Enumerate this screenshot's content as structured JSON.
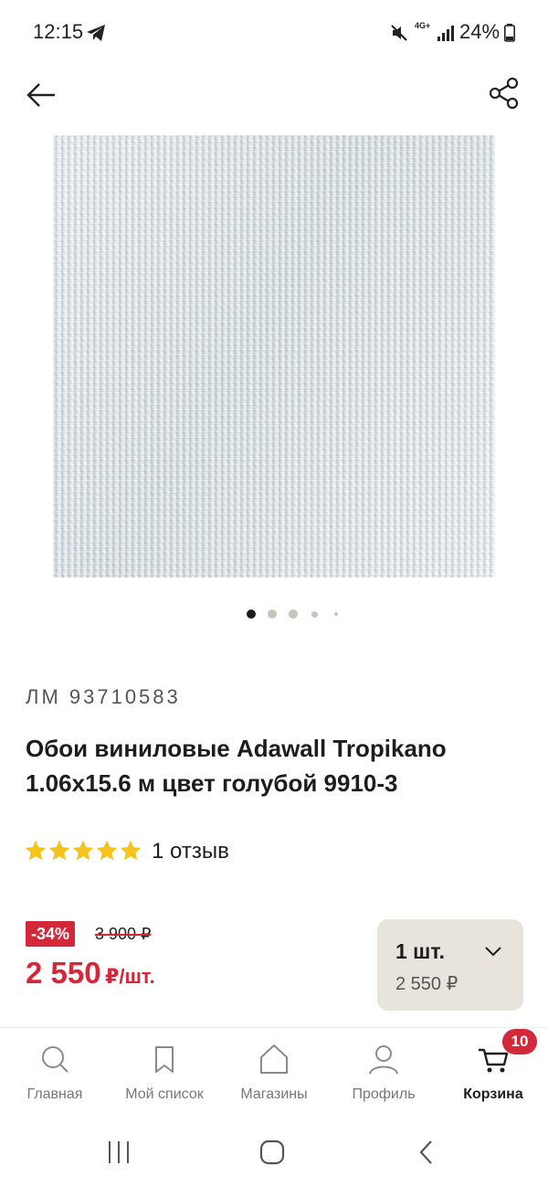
{
  "status_bar": {
    "time": "12:15",
    "network": "4G+",
    "battery": "24%"
  },
  "header": {
    "back_icon": "arrow-left-icon",
    "share_icon": "share-icon"
  },
  "gallery": {
    "image_description_icon": "product-photo",
    "dots_count": 5,
    "active_dot": 0
  },
  "product": {
    "sku": "ЛМ 93710583",
    "title": "Обои виниловые Adawall Tropikano 1.06х15.6 м цвет голубой 9910-3",
    "rating": 5,
    "reviews": "1 отзыв",
    "discount": "-34%",
    "old_price": "3 900 ₽",
    "price": "2 550",
    "price_unit": "₽/шт."
  },
  "quantity": {
    "label": "1 шт.",
    "price": "2 550 ₽"
  },
  "bottom_nav": {
    "items": [
      {
        "label": "Главная",
        "icon": "search-icon"
      },
      {
        "label": "Мой список",
        "icon": "bookmark-icon"
      },
      {
        "label": "Магазины",
        "icon": "store-icon"
      },
      {
        "label": "Профиль",
        "icon": "profile-icon"
      },
      {
        "label": "Корзина",
        "icon": "cart-icon"
      }
    ],
    "active_index": 4,
    "cart_count": "10"
  },
  "colors": {
    "accent_red": "#d22839",
    "qty_bg": "#e8e4dc",
    "star_yellow": "#f6c21c"
  }
}
